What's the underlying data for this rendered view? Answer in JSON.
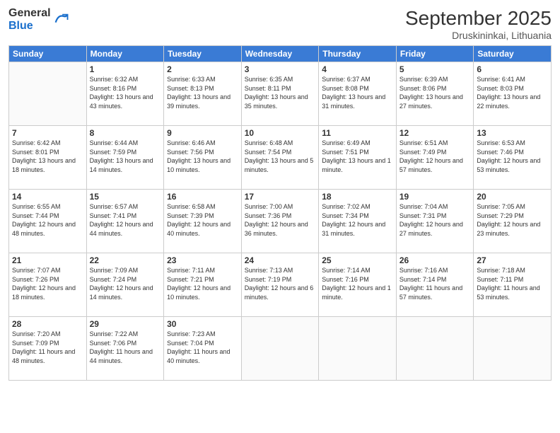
{
  "logo": {
    "general": "General",
    "blue": "Blue"
  },
  "header": {
    "month_year": "September 2025",
    "location": "Druskininkai, Lithuania"
  },
  "weekdays": [
    "Sunday",
    "Monday",
    "Tuesday",
    "Wednesday",
    "Thursday",
    "Friday",
    "Saturday"
  ],
  "weeks": [
    [
      {
        "day": "",
        "sunrise": "",
        "sunset": "",
        "daylight": ""
      },
      {
        "day": "1",
        "sunrise": "Sunrise: 6:32 AM",
        "sunset": "Sunset: 8:16 PM",
        "daylight": "Daylight: 13 hours and 43 minutes."
      },
      {
        "day": "2",
        "sunrise": "Sunrise: 6:33 AM",
        "sunset": "Sunset: 8:13 PM",
        "daylight": "Daylight: 13 hours and 39 minutes."
      },
      {
        "day": "3",
        "sunrise": "Sunrise: 6:35 AM",
        "sunset": "Sunset: 8:11 PM",
        "daylight": "Daylight: 13 hours and 35 minutes."
      },
      {
        "day": "4",
        "sunrise": "Sunrise: 6:37 AM",
        "sunset": "Sunset: 8:08 PM",
        "daylight": "Daylight: 13 hours and 31 minutes."
      },
      {
        "day": "5",
        "sunrise": "Sunrise: 6:39 AM",
        "sunset": "Sunset: 8:06 PM",
        "daylight": "Daylight: 13 hours and 27 minutes."
      },
      {
        "day": "6",
        "sunrise": "Sunrise: 6:41 AM",
        "sunset": "Sunset: 8:03 PM",
        "daylight": "Daylight: 13 hours and 22 minutes."
      }
    ],
    [
      {
        "day": "7",
        "sunrise": "Sunrise: 6:42 AM",
        "sunset": "Sunset: 8:01 PM",
        "daylight": "Daylight: 13 hours and 18 minutes."
      },
      {
        "day": "8",
        "sunrise": "Sunrise: 6:44 AM",
        "sunset": "Sunset: 7:59 PM",
        "daylight": "Daylight: 13 hours and 14 minutes."
      },
      {
        "day": "9",
        "sunrise": "Sunrise: 6:46 AM",
        "sunset": "Sunset: 7:56 PM",
        "daylight": "Daylight: 13 hours and 10 minutes."
      },
      {
        "day": "10",
        "sunrise": "Sunrise: 6:48 AM",
        "sunset": "Sunset: 7:54 PM",
        "daylight": "Daylight: 13 hours and 5 minutes."
      },
      {
        "day": "11",
        "sunrise": "Sunrise: 6:49 AM",
        "sunset": "Sunset: 7:51 PM",
        "daylight": "Daylight: 13 hours and 1 minute."
      },
      {
        "day": "12",
        "sunrise": "Sunrise: 6:51 AM",
        "sunset": "Sunset: 7:49 PM",
        "daylight": "Daylight: 12 hours and 57 minutes."
      },
      {
        "day": "13",
        "sunrise": "Sunrise: 6:53 AM",
        "sunset": "Sunset: 7:46 PM",
        "daylight": "Daylight: 12 hours and 53 minutes."
      }
    ],
    [
      {
        "day": "14",
        "sunrise": "Sunrise: 6:55 AM",
        "sunset": "Sunset: 7:44 PM",
        "daylight": "Daylight: 12 hours and 48 minutes."
      },
      {
        "day": "15",
        "sunrise": "Sunrise: 6:57 AM",
        "sunset": "Sunset: 7:41 PM",
        "daylight": "Daylight: 12 hours and 44 minutes."
      },
      {
        "day": "16",
        "sunrise": "Sunrise: 6:58 AM",
        "sunset": "Sunset: 7:39 PM",
        "daylight": "Daylight: 12 hours and 40 minutes."
      },
      {
        "day": "17",
        "sunrise": "Sunrise: 7:00 AM",
        "sunset": "Sunset: 7:36 PM",
        "daylight": "Daylight: 12 hours and 36 minutes."
      },
      {
        "day": "18",
        "sunrise": "Sunrise: 7:02 AM",
        "sunset": "Sunset: 7:34 PM",
        "daylight": "Daylight: 12 hours and 31 minutes."
      },
      {
        "day": "19",
        "sunrise": "Sunrise: 7:04 AM",
        "sunset": "Sunset: 7:31 PM",
        "daylight": "Daylight: 12 hours and 27 minutes."
      },
      {
        "day": "20",
        "sunrise": "Sunrise: 7:05 AM",
        "sunset": "Sunset: 7:29 PM",
        "daylight": "Daylight: 12 hours and 23 minutes."
      }
    ],
    [
      {
        "day": "21",
        "sunrise": "Sunrise: 7:07 AM",
        "sunset": "Sunset: 7:26 PM",
        "daylight": "Daylight: 12 hours and 18 minutes."
      },
      {
        "day": "22",
        "sunrise": "Sunrise: 7:09 AM",
        "sunset": "Sunset: 7:24 PM",
        "daylight": "Daylight: 12 hours and 14 minutes."
      },
      {
        "day": "23",
        "sunrise": "Sunrise: 7:11 AM",
        "sunset": "Sunset: 7:21 PM",
        "daylight": "Daylight: 12 hours and 10 minutes."
      },
      {
        "day": "24",
        "sunrise": "Sunrise: 7:13 AM",
        "sunset": "Sunset: 7:19 PM",
        "daylight": "Daylight: 12 hours and 6 minutes."
      },
      {
        "day": "25",
        "sunrise": "Sunrise: 7:14 AM",
        "sunset": "Sunset: 7:16 PM",
        "daylight": "Daylight: 12 hours and 1 minute."
      },
      {
        "day": "26",
        "sunrise": "Sunrise: 7:16 AM",
        "sunset": "Sunset: 7:14 PM",
        "daylight": "Daylight: 11 hours and 57 minutes."
      },
      {
        "day": "27",
        "sunrise": "Sunrise: 7:18 AM",
        "sunset": "Sunset: 7:11 PM",
        "daylight": "Daylight: 11 hours and 53 minutes."
      }
    ],
    [
      {
        "day": "28",
        "sunrise": "Sunrise: 7:20 AM",
        "sunset": "Sunset: 7:09 PM",
        "daylight": "Daylight: 11 hours and 48 minutes."
      },
      {
        "day": "29",
        "sunrise": "Sunrise: 7:22 AM",
        "sunset": "Sunset: 7:06 PM",
        "daylight": "Daylight: 11 hours and 44 minutes."
      },
      {
        "day": "30",
        "sunrise": "Sunrise: 7:23 AM",
        "sunset": "Sunset: 7:04 PM",
        "daylight": "Daylight: 11 hours and 40 minutes."
      },
      {
        "day": "",
        "sunrise": "",
        "sunset": "",
        "daylight": ""
      },
      {
        "day": "",
        "sunrise": "",
        "sunset": "",
        "daylight": ""
      },
      {
        "day": "",
        "sunrise": "",
        "sunset": "",
        "daylight": ""
      },
      {
        "day": "",
        "sunrise": "",
        "sunset": "",
        "daylight": ""
      }
    ]
  ]
}
